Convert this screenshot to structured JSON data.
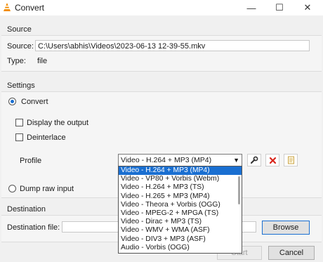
{
  "window": {
    "title": "Convert",
    "minimize_glyph": "—",
    "maximize_glyph": "☐",
    "close_glyph": "✕",
    "icon": "vlc-cone-icon"
  },
  "source": {
    "section_label": "Source",
    "source_label": "Source:",
    "source_value": "C:\\Users\\abhis\\Videos\\2023-06-13 12-39-55.mkv",
    "type_label": "Type:",
    "type_value": "file"
  },
  "settings": {
    "section_label": "Settings",
    "convert_label": "Convert",
    "display_output_label": "Display the output",
    "deinterlace_label": "Deinterlace",
    "profile_label": "Profile",
    "profile_selected": "Video - H.264 + MP3 (MP4)",
    "profile_options": [
      "Video - H.264 + MP3 (MP4)",
      "Video - VP80 + Vorbis (Webm)",
      "Video - H.264 + MP3 (TS)",
      "Video - H.265 + MP3 (MP4)",
      "Video - Theora + Vorbis (OGG)",
      "Video - MPEG-2 + MPGA (TS)",
      "Video - Dirac + MP3 (TS)",
      "Video - WMV + WMA (ASF)",
      "Video - DIV3 + MP3 (ASF)",
      "Audio - Vorbis (OGG)"
    ],
    "dump_raw_label": "Dump raw input",
    "edit_icon": "wrench-icon",
    "delete_icon": "red-x-icon",
    "new_icon": "new-profile-icon"
  },
  "destination": {
    "section_label": "Destination",
    "file_label": "Destination file:",
    "file_value": "",
    "browse_label": "Browse"
  },
  "buttons": {
    "start_label": "Start",
    "cancel_label": "Cancel"
  },
  "colors": {
    "accent": "#1a6fd1",
    "delete_red": "#d9261c"
  }
}
